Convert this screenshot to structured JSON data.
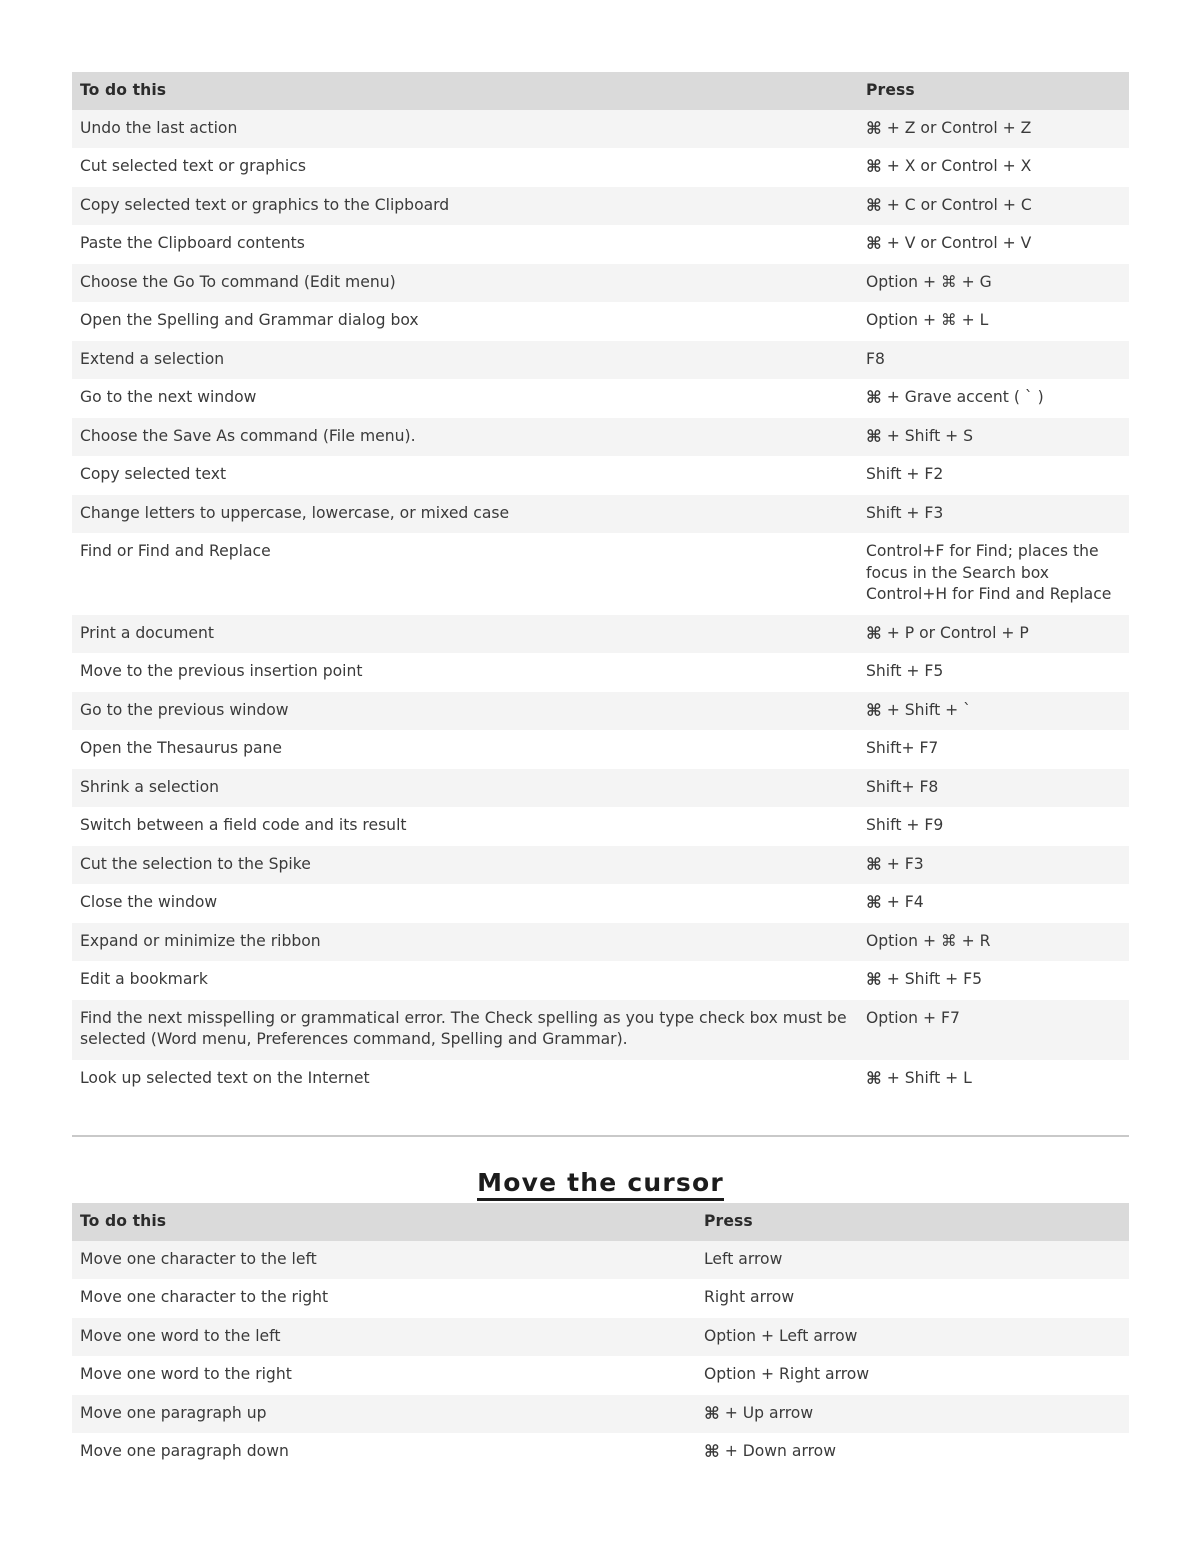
{
  "document": {
    "command_symbol": "⌘",
    "colors": {
      "header_background": "#dadada",
      "row_odd_background": "#f4f4f4",
      "row_even_background": "#ffffff",
      "text": "#3a3a3a",
      "rule": "#c9c9c9",
      "page_background": "#ffffff"
    }
  },
  "shortcuts_table": {
    "columns": [
      "To do this",
      "Press"
    ],
    "rows": [
      {
        "action": "Undo the last action",
        "press_prefix_cmd": true,
        "press": "+ Z or Control + Z"
      },
      {
        "action": "Cut selected text or graphics",
        "press_prefix_cmd": true,
        "press": "+ X or Control + X"
      },
      {
        "action": "Copy selected text or graphics to the Clipboard",
        "press_prefix_cmd": true,
        "press": "+ C or Control + C"
      },
      {
        "action": "Paste the Clipboard contents",
        "press_prefix_cmd": true,
        "press": "+ V or Control + V"
      },
      {
        "action": "Choose the Go To command (Edit menu)",
        "press_prefix_cmd": false,
        "press": "Option + ⌘ + G"
      },
      {
        "action": "Open the Spelling and Grammar dialog box",
        "press_prefix_cmd": false,
        "press": "Option + ⌘ + L"
      },
      {
        "action": "Extend a selection",
        "press_prefix_cmd": false,
        "press": "F8"
      },
      {
        "action": "Go to the next window",
        "press_prefix_cmd": true,
        "press": "+ Grave accent ( ` )"
      },
      {
        "action": "Choose the Save As command (File menu).",
        "press_prefix_cmd": true,
        "press": "+ Shift + S"
      },
      {
        "action": "Copy selected text",
        "press_prefix_cmd": false,
        "press": "Shift + F2"
      },
      {
        "action": "Change letters to uppercase, lowercase, or mixed case",
        "press_prefix_cmd": false,
        "press": "Shift + F3"
      },
      {
        "action": "Find or Find and Replace",
        "press_prefix_cmd": false,
        "press": "Control+F for Find; places the focus in the Search box\nControl+H for Find and Replace"
      },
      {
        "action": "Print a document",
        "press_prefix_cmd": true,
        "press": "+ P or Control + P"
      },
      {
        "action": "Move to the previous insertion point",
        "press_prefix_cmd": false,
        "press": "Shift + F5"
      },
      {
        "action": "Go to the previous window",
        "press_prefix_cmd": true,
        "press": "+ Shift + `"
      },
      {
        "action": "Open the Thesaurus pane",
        "press_prefix_cmd": false,
        "press": "Shift+ F7"
      },
      {
        "action": "Shrink a selection",
        "press_prefix_cmd": false,
        "press": "Shift+ F8"
      },
      {
        "action": "Switch between a field code and its result",
        "press_prefix_cmd": false,
        "press": "Shift + F9"
      },
      {
        "action": "Cut the selection to the Spike",
        "press_prefix_cmd": true,
        "press": "+ F3"
      },
      {
        "action": "Close the window",
        "press_prefix_cmd": true,
        "press": "+ F4"
      },
      {
        "action": "Expand or minimize the ribbon",
        "press_prefix_cmd": false,
        "press": "Option + ⌘ + R"
      },
      {
        "action": "Edit a bookmark",
        "press_prefix_cmd": true,
        "press": "+ Shift + F5"
      },
      {
        "action": "Find the next misspelling or grammatical error. The Check spelling as you type check box must be selected (Word menu, Preferences command, Spelling and Grammar).",
        "press_prefix_cmd": false,
        "press": "Option + F7"
      },
      {
        "action": "Look up selected text on the Internet",
        "press_prefix_cmd": true,
        "press": "+ Shift + L"
      }
    ]
  },
  "cursor_section": {
    "heading": "Move the cursor",
    "columns": [
      "To do this",
      "Press"
    ],
    "rows": [
      {
        "action": "Move one character to the left",
        "press_prefix_cmd": false,
        "press": "Left arrow"
      },
      {
        "action": "Move one character to the right",
        "press_prefix_cmd": false,
        "press": "Right arrow"
      },
      {
        "action": "Move one word to the left",
        "press_prefix_cmd": false,
        "press": "Option + Left arrow"
      },
      {
        "action": "Move one word to the right",
        "press_prefix_cmd": false,
        "press": "Option + Right arrow"
      },
      {
        "action": "Move one paragraph up",
        "press_prefix_cmd": true,
        "press": "+ Up arrow"
      },
      {
        "action": "Move one paragraph down",
        "press_prefix_cmd": true,
        "press": "+ Down arrow"
      }
    ]
  }
}
